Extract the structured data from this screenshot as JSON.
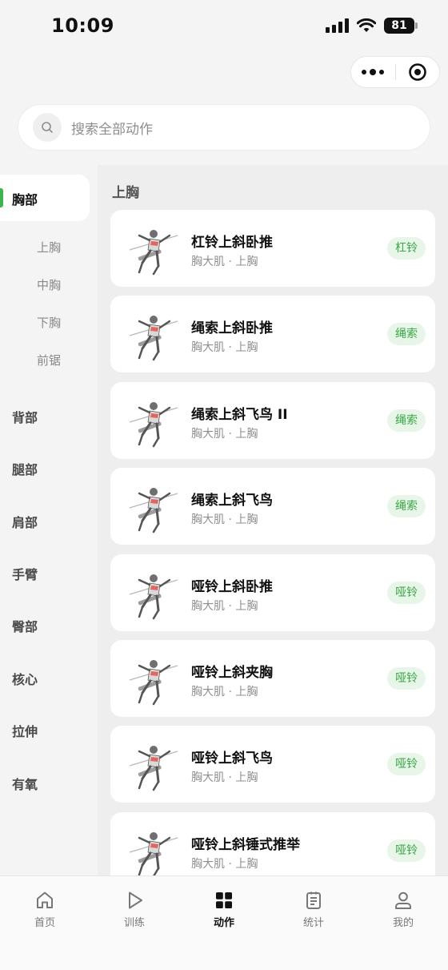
{
  "status_bar": {
    "time": "10:09",
    "battery": "81"
  },
  "search": {
    "placeholder": "搜索全部动作"
  },
  "sidebar": {
    "active_category": "胸部",
    "subcategories": [
      "上胸",
      "中胸",
      "下胸",
      "前锯"
    ],
    "categories": [
      "背部",
      "腿部",
      "肩部",
      "手臂",
      "臀部",
      "核心",
      "拉伸",
      "有氧"
    ]
  },
  "section": {
    "title": "上胸"
  },
  "exercises": [
    {
      "name": "杠铃上斜卧推",
      "muscle": "胸大肌 · 上胸",
      "equipment": "杠铃"
    },
    {
      "name": "绳索上斜卧推",
      "muscle": "胸大肌 · 上胸",
      "equipment": "绳索"
    },
    {
      "name": "绳索上斜飞鸟 II",
      "muscle": "胸大肌 · 上胸",
      "equipment": "绳索"
    },
    {
      "name": "绳索上斜飞鸟",
      "muscle": "胸大肌 · 上胸",
      "equipment": "绳索"
    },
    {
      "name": "哑铃上斜卧推",
      "muscle": "胸大肌 · 上胸",
      "equipment": "哑铃"
    },
    {
      "name": "哑铃上斜夹胸",
      "muscle": "胸大肌 · 上胸",
      "equipment": "哑铃"
    },
    {
      "name": "哑铃上斜飞鸟",
      "muscle": "胸大肌 · 上胸",
      "equipment": "哑铃"
    },
    {
      "name": "哑铃上斜锤式推举",
      "muscle": "胸大肌 · 上胸",
      "equipment": "哑铃"
    }
  ],
  "tabbar": {
    "items": [
      {
        "label": "首页",
        "icon": "home-icon"
      },
      {
        "label": "训练",
        "icon": "play-icon"
      },
      {
        "label": "动作",
        "icon": "grid-icon"
      },
      {
        "label": "统计",
        "icon": "clipboard-icon"
      },
      {
        "label": "我的",
        "icon": "user-icon"
      }
    ],
    "active": "动作"
  },
  "colors": {
    "accent": "#3cb64a",
    "tag_bg": "#e8f6e9",
    "tag_text": "#3aa845"
  }
}
